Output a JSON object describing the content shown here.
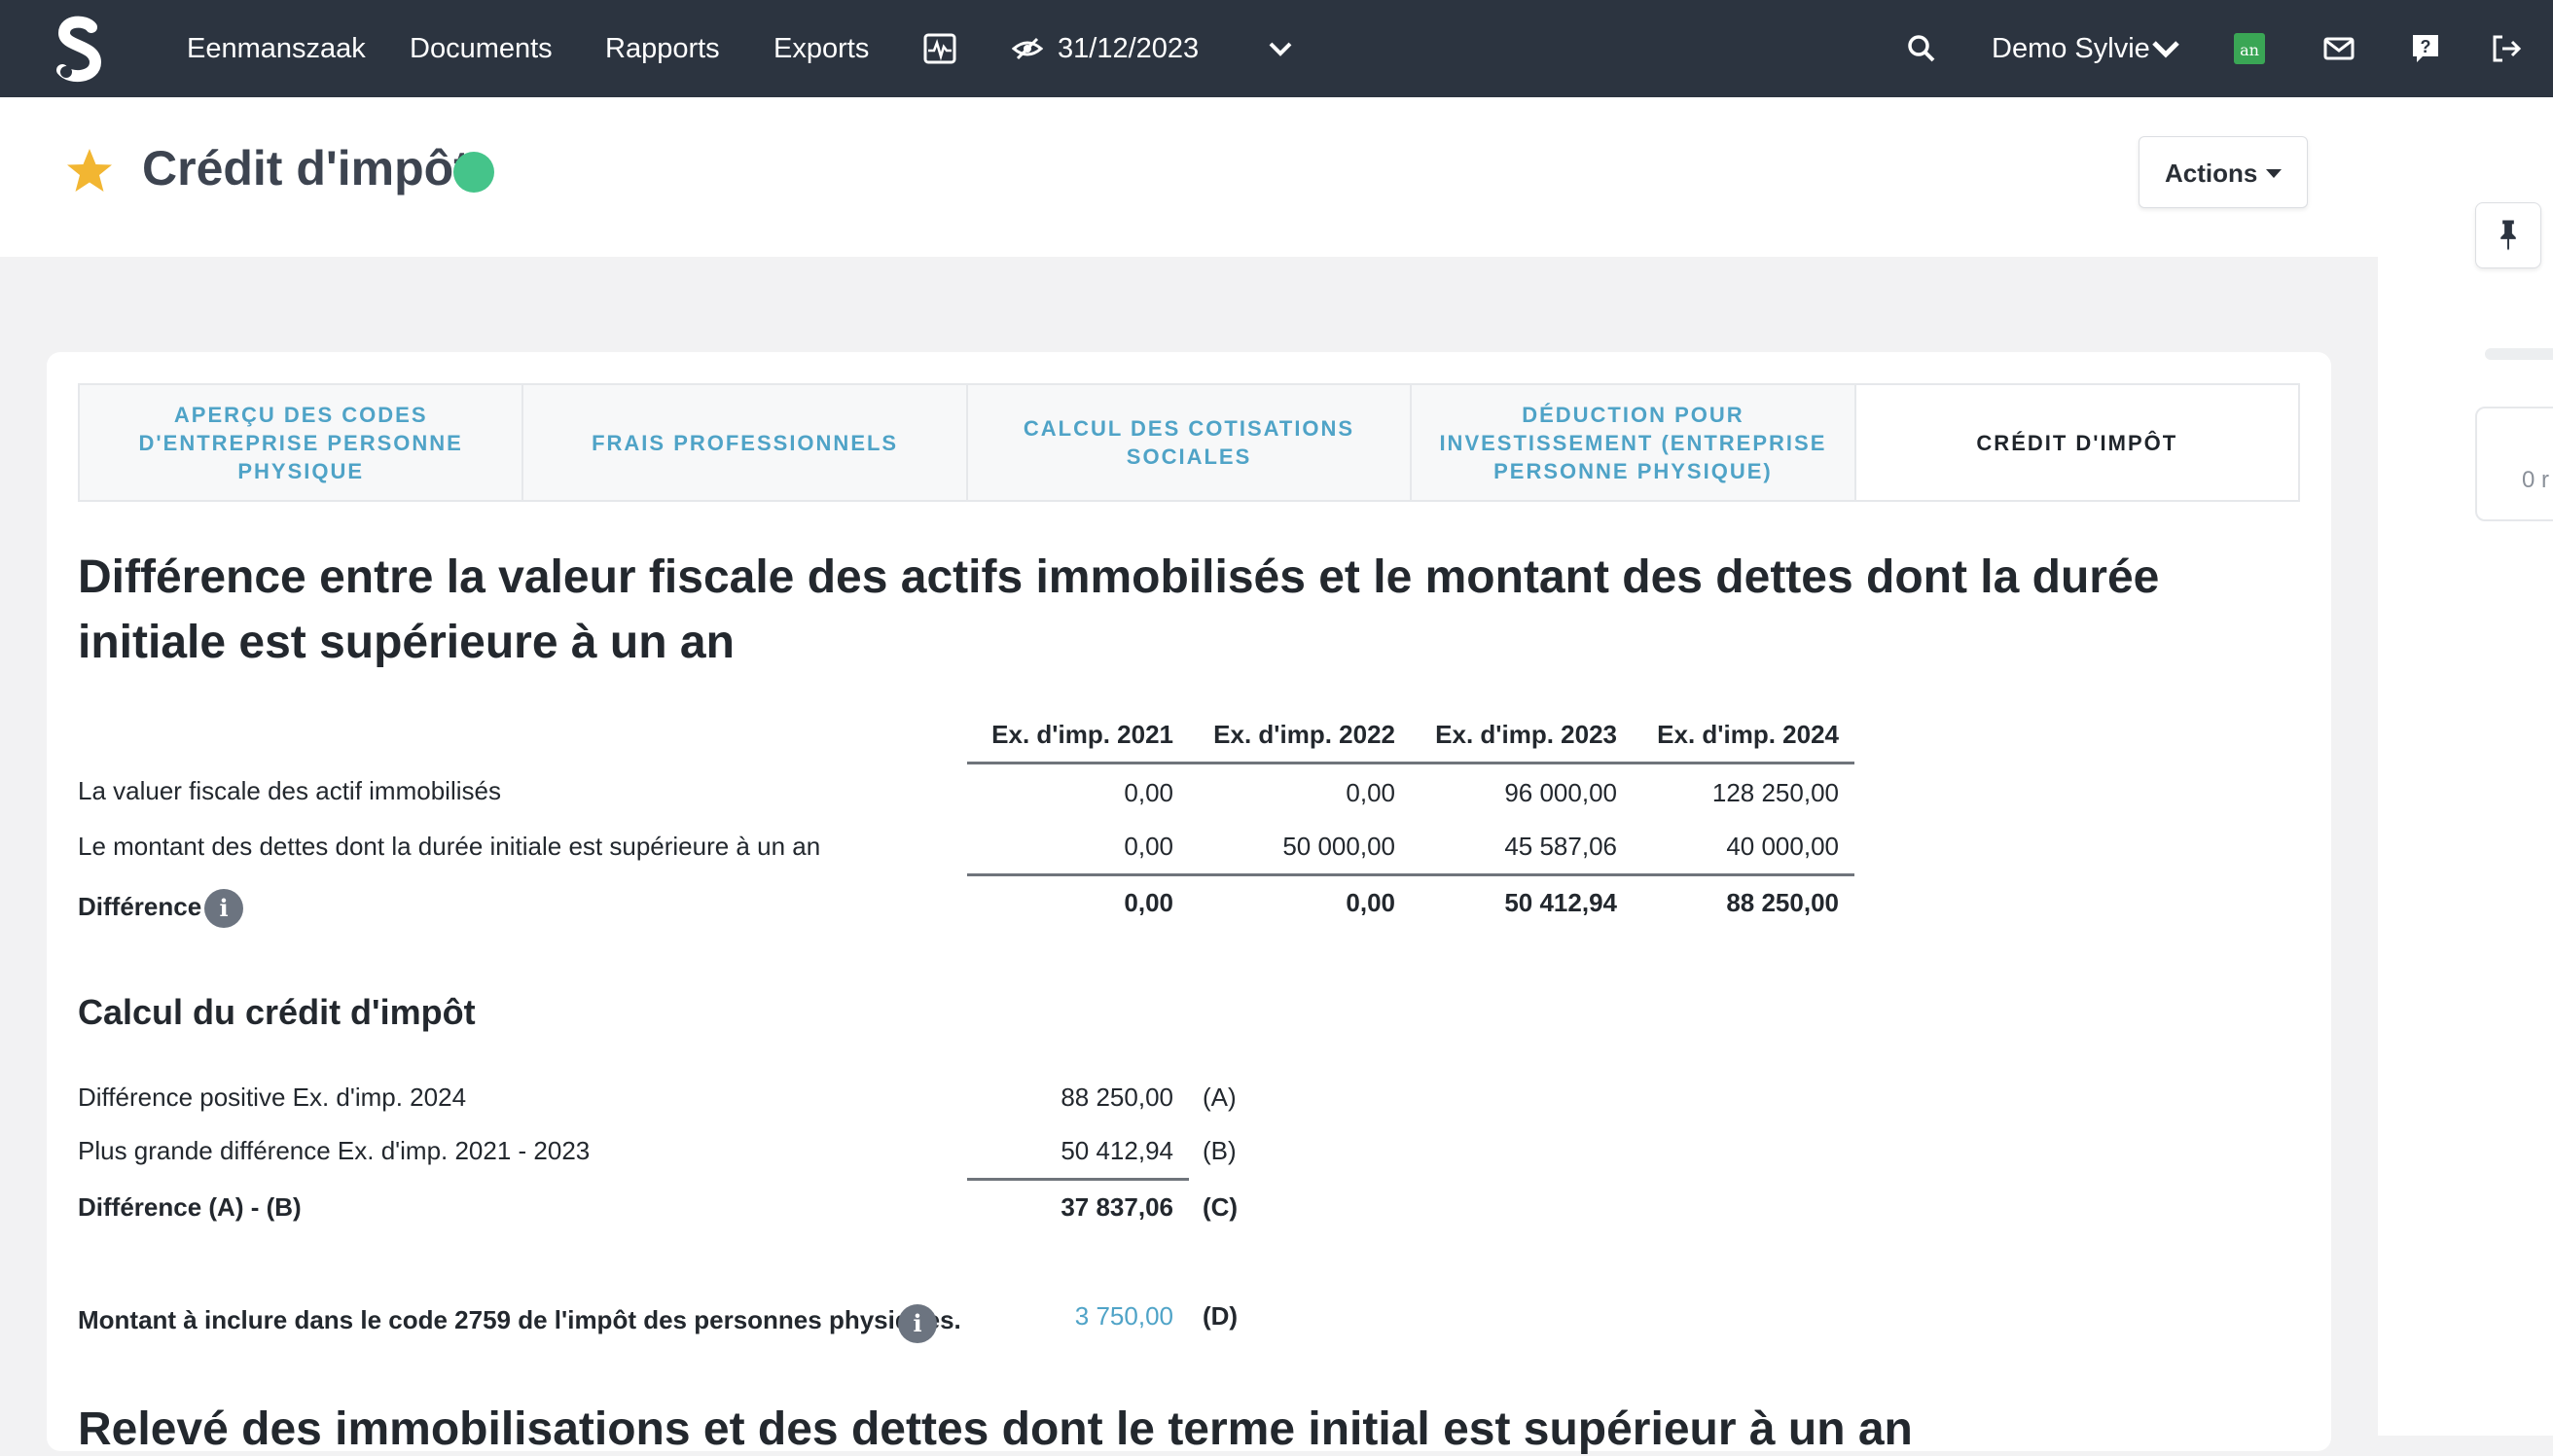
{
  "topnav": {
    "logo_icon": "s-logo-icon",
    "items": [
      "Eenmanszaak",
      "Documents",
      "Rapports",
      "Exports"
    ],
    "date": "31/12/2023",
    "user": "Demo Sylvie",
    "badge_text": "an"
  },
  "header": {
    "title": "Crédit d'impôt",
    "actions_label": "Actions"
  },
  "tabs": [
    "APERÇU DES CODES D'ENTREPRISE PERSONNE PHYSIQUE",
    "FRAIS PROFESSIONNELS",
    "CALCUL DES COTISATIONS SOCIALES",
    "DÉDUCTION POUR INVESTISSEMENT (ENTREPRISE PERSONNE PHYSIQUE)",
    "CRÉDIT D'IMPÔT"
  ],
  "section1": {
    "heading": "Différence entre la valeur fiscale des actifs immobilisés et le montant des dettes dont la durée initiale est supérieure à un an",
    "columns": [
      "Ex. d'imp. 2021",
      "Ex. d'imp. 2022",
      "Ex. d'imp. 2023",
      "Ex. d'imp. 2024"
    ],
    "rows": [
      {
        "label": "La valuer fiscale des actif immobilisés",
        "values": [
          "0,00",
          "0,00",
          "96 000,00",
          "128 250,00"
        ]
      },
      {
        "label": "Le montant des dettes dont la durée initiale est supérieure à un an",
        "values": [
          "0,00",
          "50 000,00",
          "45 587,06",
          "40 000,00"
        ]
      },
      {
        "label": "Différence",
        "values": [
          "0,00",
          "0,00",
          "50 412,94",
          "88 250,00"
        ]
      }
    ]
  },
  "section2": {
    "heading": "Calcul du crédit d'impôt",
    "rows": [
      {
        "label": "Différence positive Ex. d'imp. 2024",
        "value": "88 250,00",
        "tag": "(A)"
      },
      {
        "label": "Plus grande différence Ex. d'imp. 2021 - 2023",
        "value": "50 412,94",
        "tag": "(B)"
      },
      {
        "label": "Différence (A) - (B)",
        "value": "37 837,06",
        "tag": "(C)"
      },
      {
        "label": "Montant à inclure dans le code 2759 de l'impôt des personnes physiques.",
        "value": "3 750,00",
        "tag": "(D)"
      }
    ]
  },
  "section3": {
    "heading": "Relevé des immobilisations et des dettes dont le terme initial est supérieur à un an"
  },
  "right_rail": {
    "card_text": "0 r"
  },
  "colors": {
    "nav_bg": "#2c3440",
    "accent": "#4fa3c7",
    "status": "#45c48a",
    "star": "#f2b632"
  }
}
